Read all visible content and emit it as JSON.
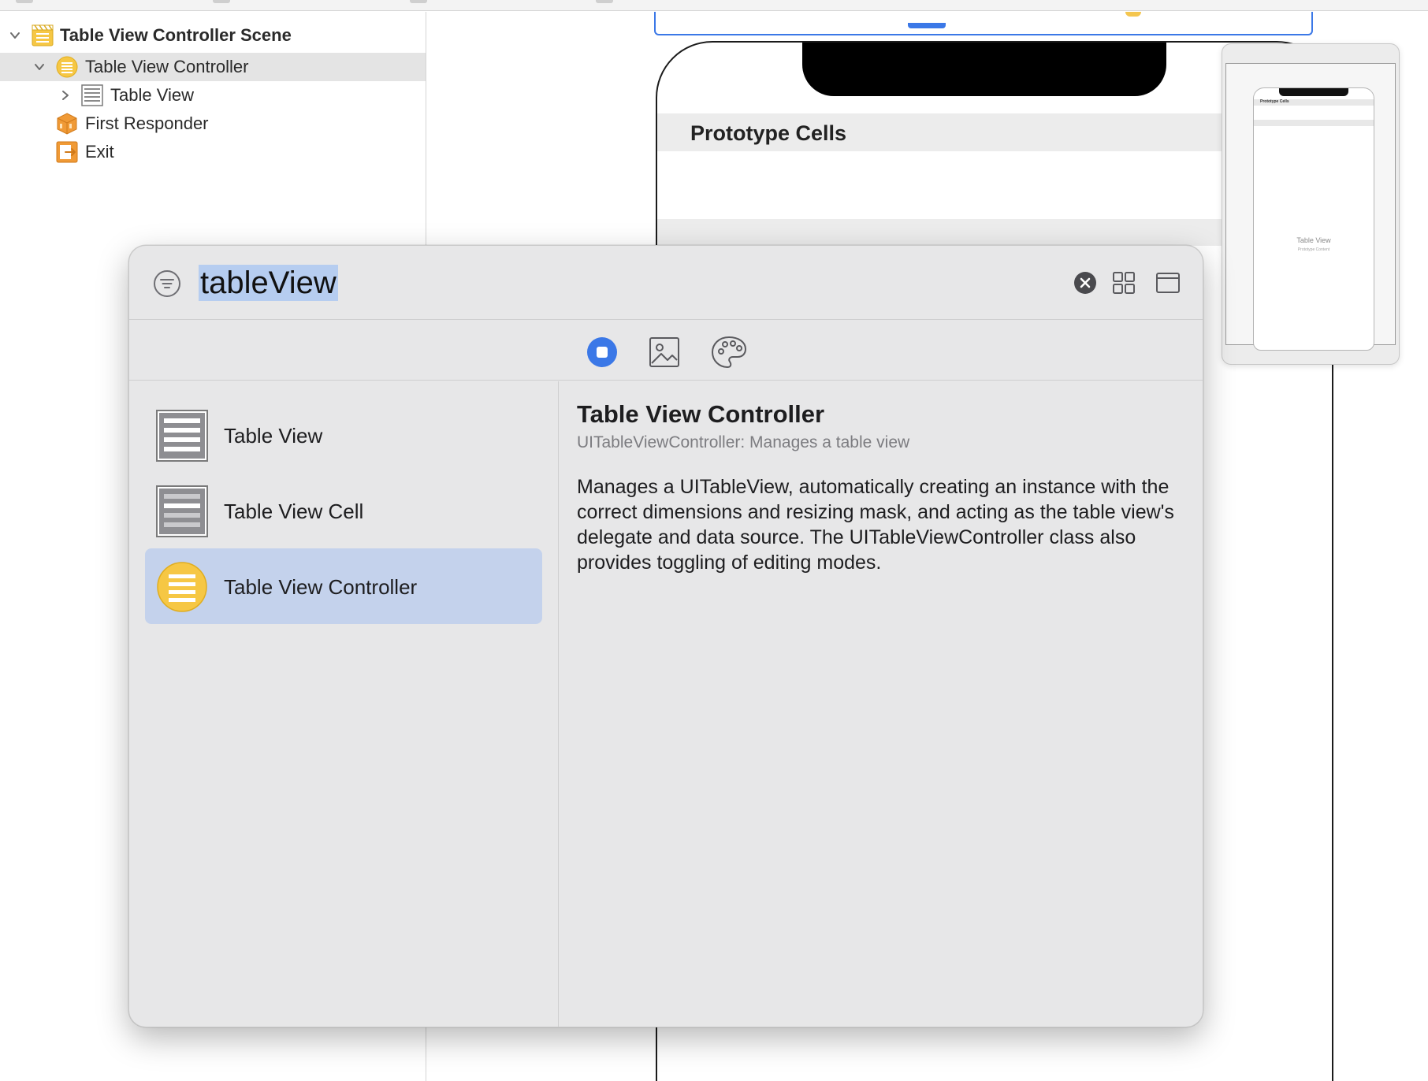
{
  "outline": {
    "scene_label": "Table View Controller Scene",
    "controller_label": "Table View Controller",
    "tableview_label": "Table View",
    "responder_label": "First Responder",
    "exit_label": "Exit"
  },
  "canvas": {
    "prototype_cells": "Prototype Cells",
    "minimap_header": "Prototype Cells",
    "minimap_title": "Table View",
    "minimap_subtitle": "Prototype Content"
  },
  "library": {
    "search_value": "tableView",
    "items": [
      {
        "label": "Table View",
        "icon": "table-view-icon"
      },
      {
        "label": "Table View Cell",
        "icon": "table-view-cell-icon"
      },
      {
        "label": "Table View Controller",
        "icon": "table-view-controller-icon"
      }
    ],
    "detail": {
      "title": "Table View Controller",
      "subtitle": "UITableViewController: Manages a table view",
      "description": "Manages a UITableView, automatically creating an instance with the correct dimensions and resizing mask, and acting as the table view's delegate and data source.  The UITableViewController class also provides toggling of editing modes."
    }
  },
  "colors": {
    "accent": "#3b78e7",
    "selection": "#c4d2ec",
    "controller_yellow": "#f6c744",
    "responder_orange": "#f09a36"
  }
}
